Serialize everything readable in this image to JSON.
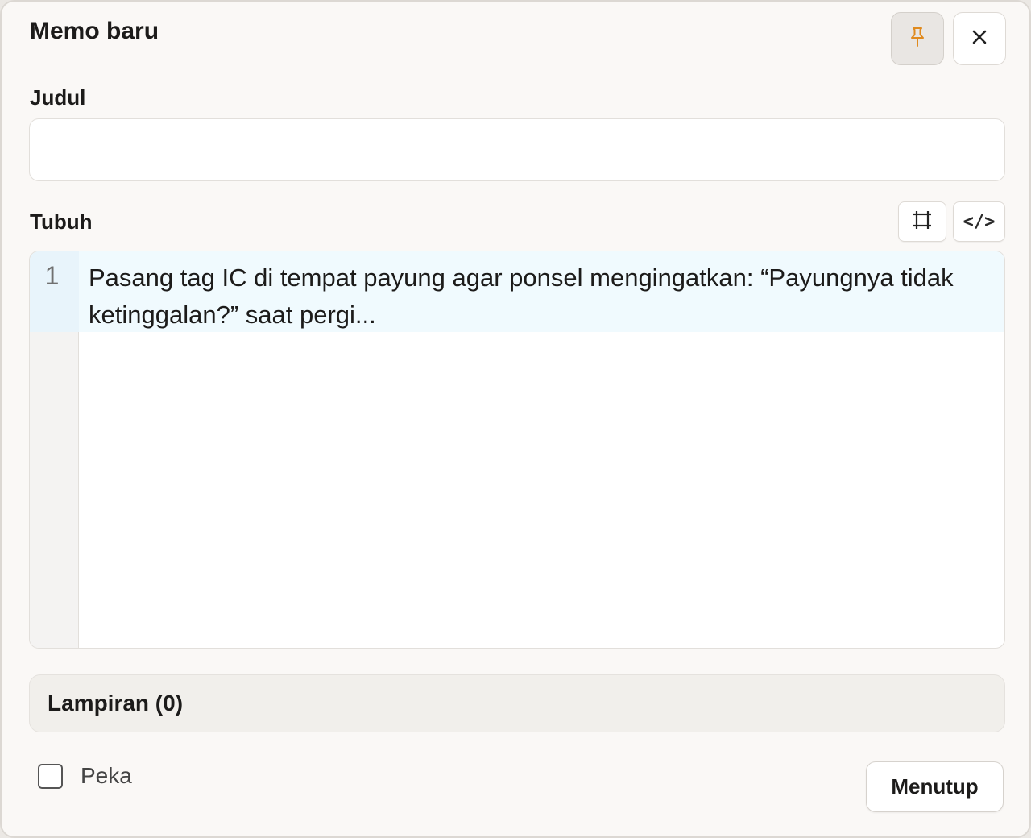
{
  "dialog": {
    "title": "Memo baru",
    "pin_icon": "pin-icon",
    "close_icon": "close-icon"
  },
  "fields": {
    "title_label": "Judul",
    "title_value": "",
    "body_label": "Tubuh"
  },
  "editor": {
    "fullscreen_icon": "fullscreen-icon",
    "code_label": "</>",
    "line_numbers": [
      "1"
    ],
    "content": "Pasang tag IC di tempat payung agar ponsel mengingatkan: “Payungnya tidak ketinggalan?” saat pergi..."
  },
  "attachments": {
    "label": "Lampiran (0)"
  },
  "footer": {
    "checkbox_label": "Peka",
    "checkbox_checked": false,
    "close_label": "Menutup"
  },
  "colors": {
    "pin_accent": "#e08a1e",
    "active_line": "#f0fafe"
  }
}
